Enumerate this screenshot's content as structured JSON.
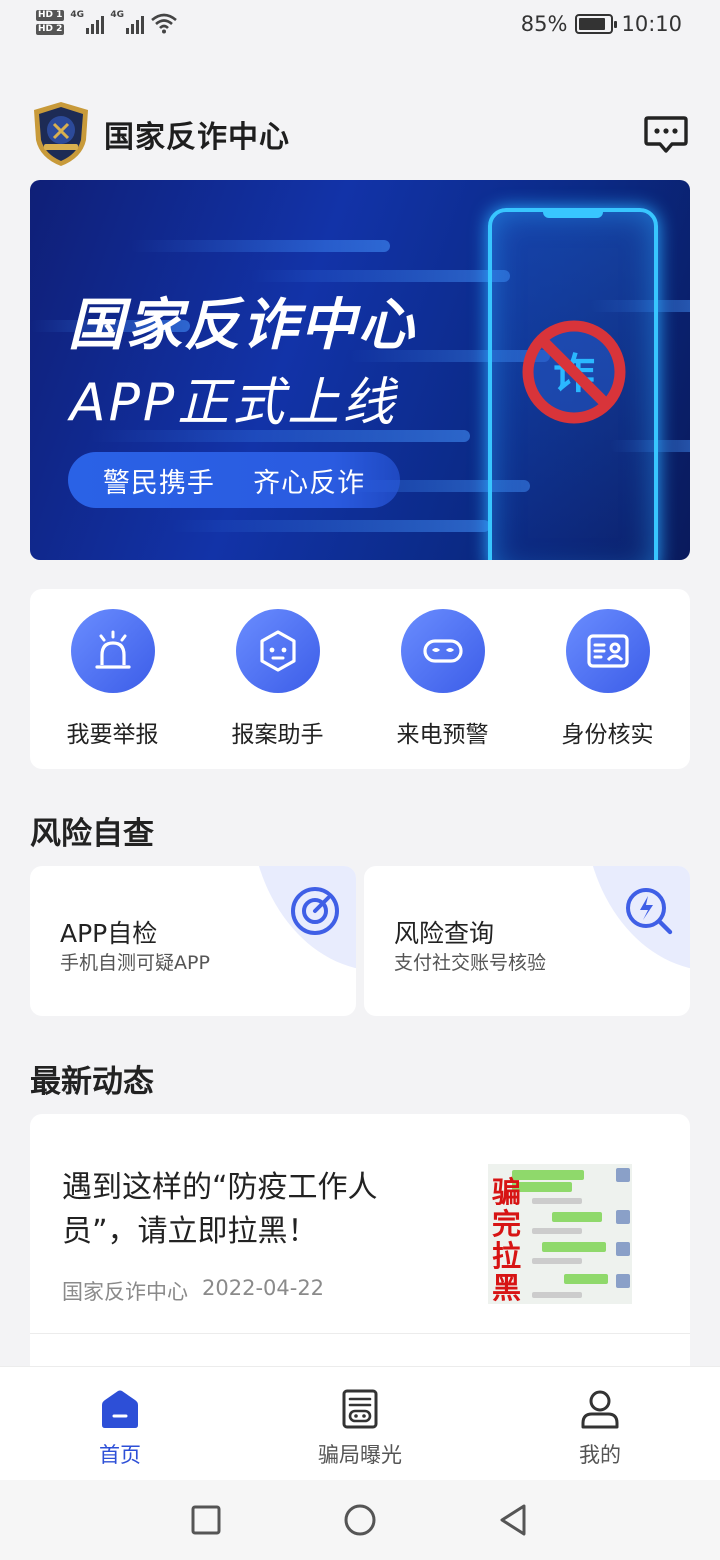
{
  "status_bar": {
    "sim1": "HD 1",
    "sim2": "HD 2",
    "net1": "4G",
    "net2": "4G",
    "battery": "85%",
    "battery_level": 0.85,
    "time": "10:10"
  },
  "header": {
    "title": "国家反诈中心",
    "logo_icon": "police-badge-icon",
    "message_icon": "message-icon"
  },
  "banner": {
    "title": "国家反诈中心",
    "subtitle": "APP正式上线",
    "slogan": "警民携手    齐心反诈",
    "sign_char": "诈"
  },
  "quick_actions": [
    {
      "label": "我要举报",
      "icon": "alarm-siren-icon"
    },
    {
      "label": "报案助手",
      "icon": "assistant-robot-icon"
    },
    {
      "label": "来电预警",
      "icon": "mask-icon"
    },
    {
      "label": "身份核实",
      "icon": "id-card-icon"
    }
  ],
  "risk_section": {
    "title": "风险自查",
    "cards": [
      {
        "title": "APP自检",
        "subtitle": "手机自测可疑APP",
        "icon": "target-icon"
      },
      {
        "title": "风险查询",
        "subtitle": "支付社交账号核验",
        "icon": "lightning-search-icon"
      }
    ]
  },
  "news_section": {
    "title": "最新动态",
    "items": [
      {
        "title": "遇到这样的“防疫工作人员”，请立即拉黑！",
        "source": "国家反诈中心",
        "date": "2022-04-22",
        "thumb_text": "骗完拉黑"
      }
    ]
  },
  "tab_bar": {
    "tabs": [
      {
        "label": "首页",
        "icon": "home-icon",
        "active": true
      },
      {
        "label": "骗局曝光",
        "icon": "exposure-list-icon",
        "active": false
      },
      {
        "label": "我的",
        "icon": "user-icon",
        "active": false
      }
    ]
  },
  "colors": {
    "accent": "#2d4fd7",
    "icon_gradient_start": "#6a8dff",
    "icon_gradient_end": "#3c5de8"
  }
}
